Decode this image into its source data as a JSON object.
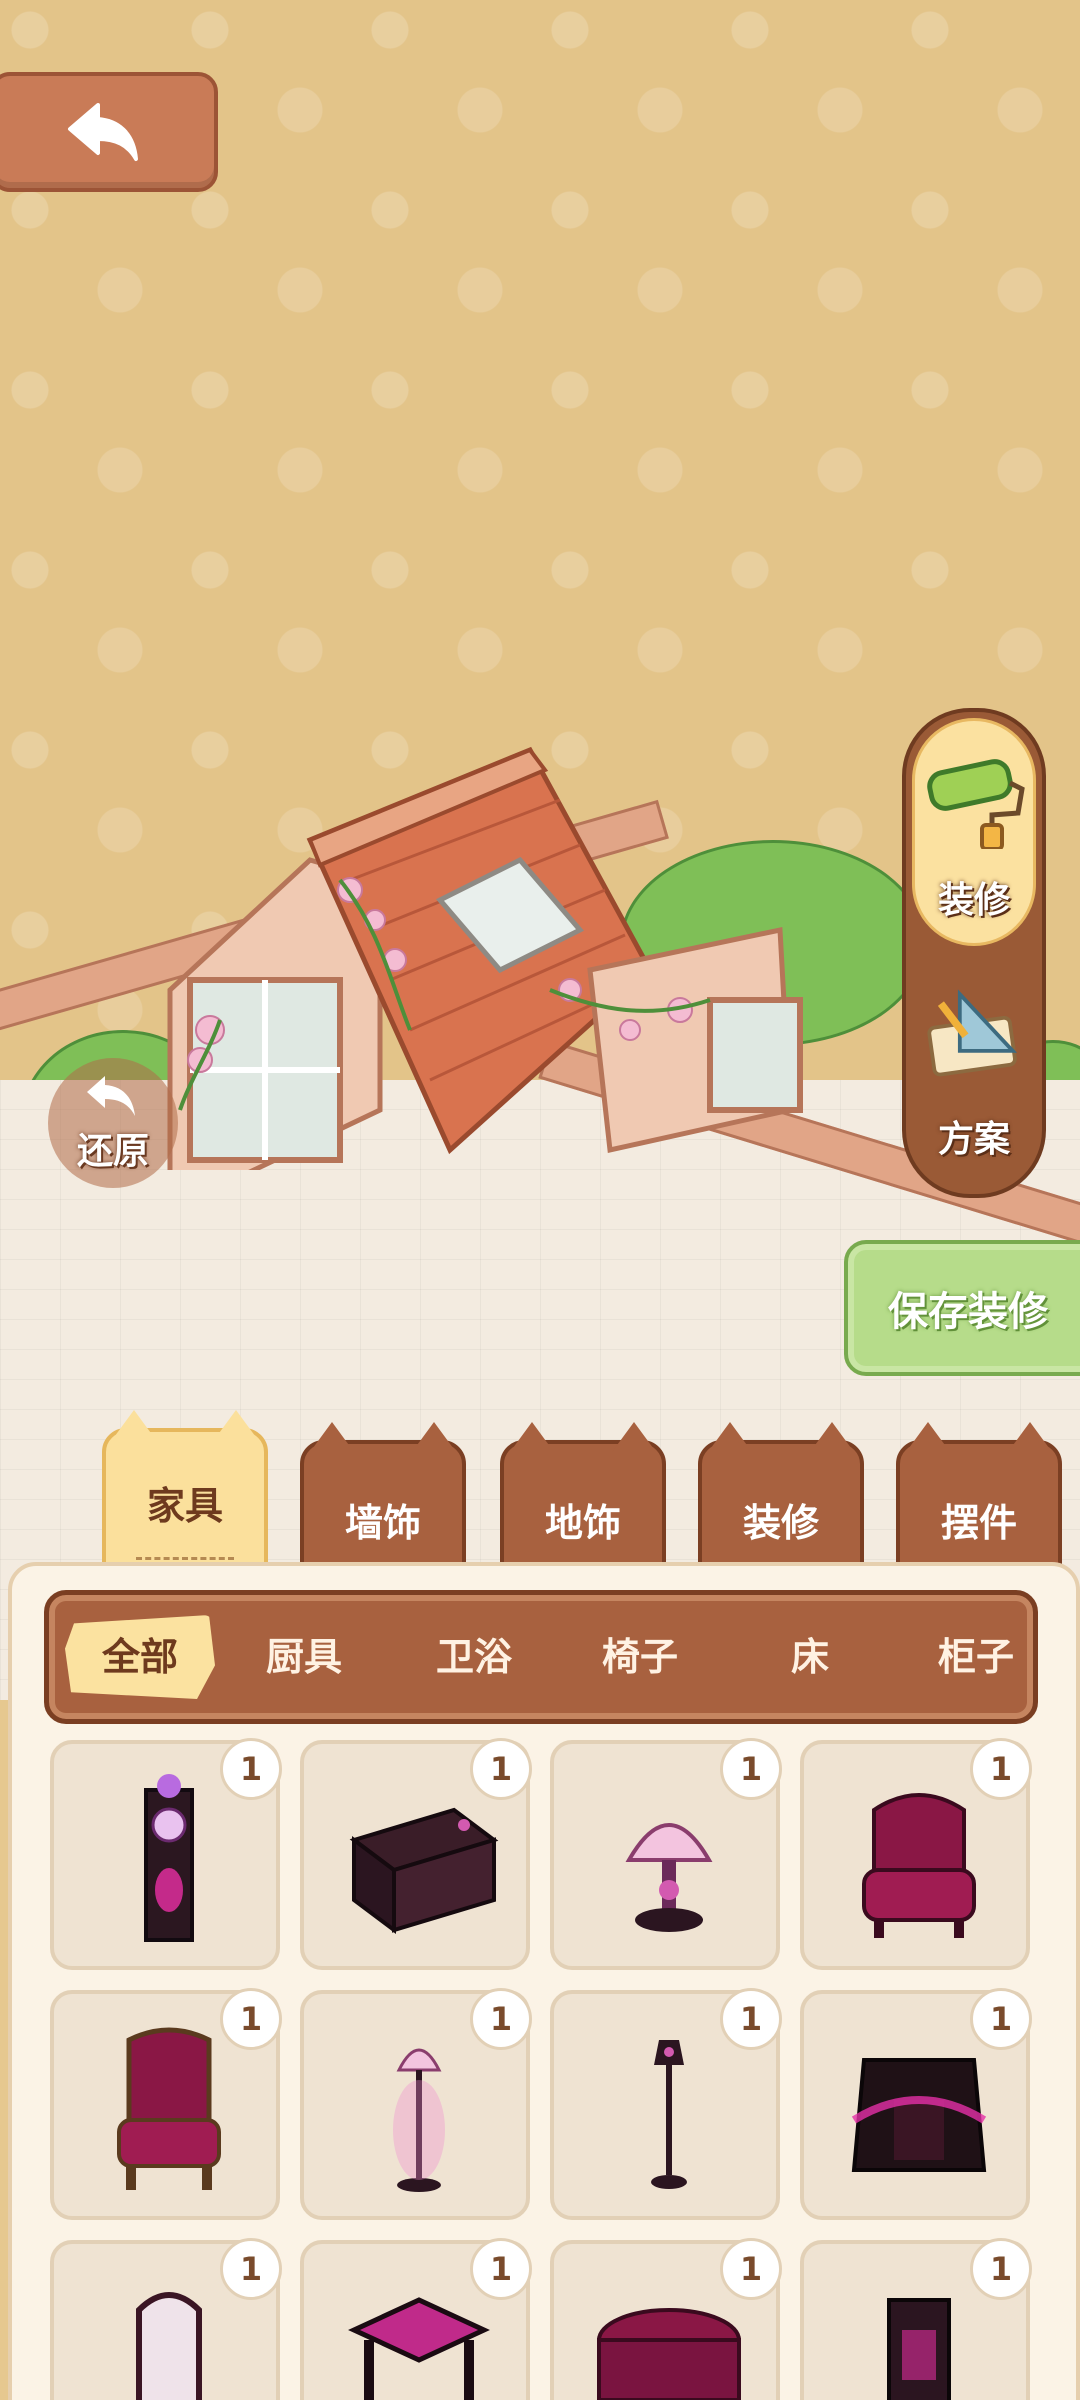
{
  "header": {
    "back_icon": "back-arrow-icon"
  },
  "scene": {
    "restore_label": "还原",
    "side_panel": {
      "decorate_label": "装修",
      "plan_label": "方案"
    },
    "save_label": "保存装修"
  },
  "tabs": [
    {
      "label": "家具",
      "active": true
    },
    {
      "label": "墙饰",
      "active": false
    },
    {
      "label": "地饰",
      "active": false
    },
    {
      "label": "装修",
      "active": false
    },
    {
      "label": "摆件",
      "active": false
    }
  ],
  "subtabs": [
    "全部",
    "厨具",
    "卫浴",
    "椅子",
    "床",
    "柜子"
  ],
  "items": [
    {
      "name": "grandfather-clock",
      "count": "1"
    },
    {
      "name": "dark-desk",
      "count": "1"
    },
    {
      "name": "table-lamp",
      "count": "1"
    },
    {
      "name": "velvet-armchair",
      "count": "1"
    },
    {
      "name": "throne-chair",
      "count": "1"
    },
    {
      "name": "floor-lamp",
      "count": "1"
    },
    {
      "name": "street-lamp",
      "count": "1"
    },
    {
      "name": "gothic-fireplace",
      "count": "1"
    },
    {
      "name": "standing-mirror",
      "count": "1"
    },
    {
      "name": "side-table",
      "count": "1"
    },
    {
      "name": "ottoman",
      "count": "1"
    },
    {
      "name": "cabinet",
      "count": "1"
    }
  ],
  "colors": {
    "accent_brown": "#a8613f",
    "active_tab": "#fbe09c",
    "save_green": "#b6dc8a",
    "magenta": "#b0195e"
  }
}
